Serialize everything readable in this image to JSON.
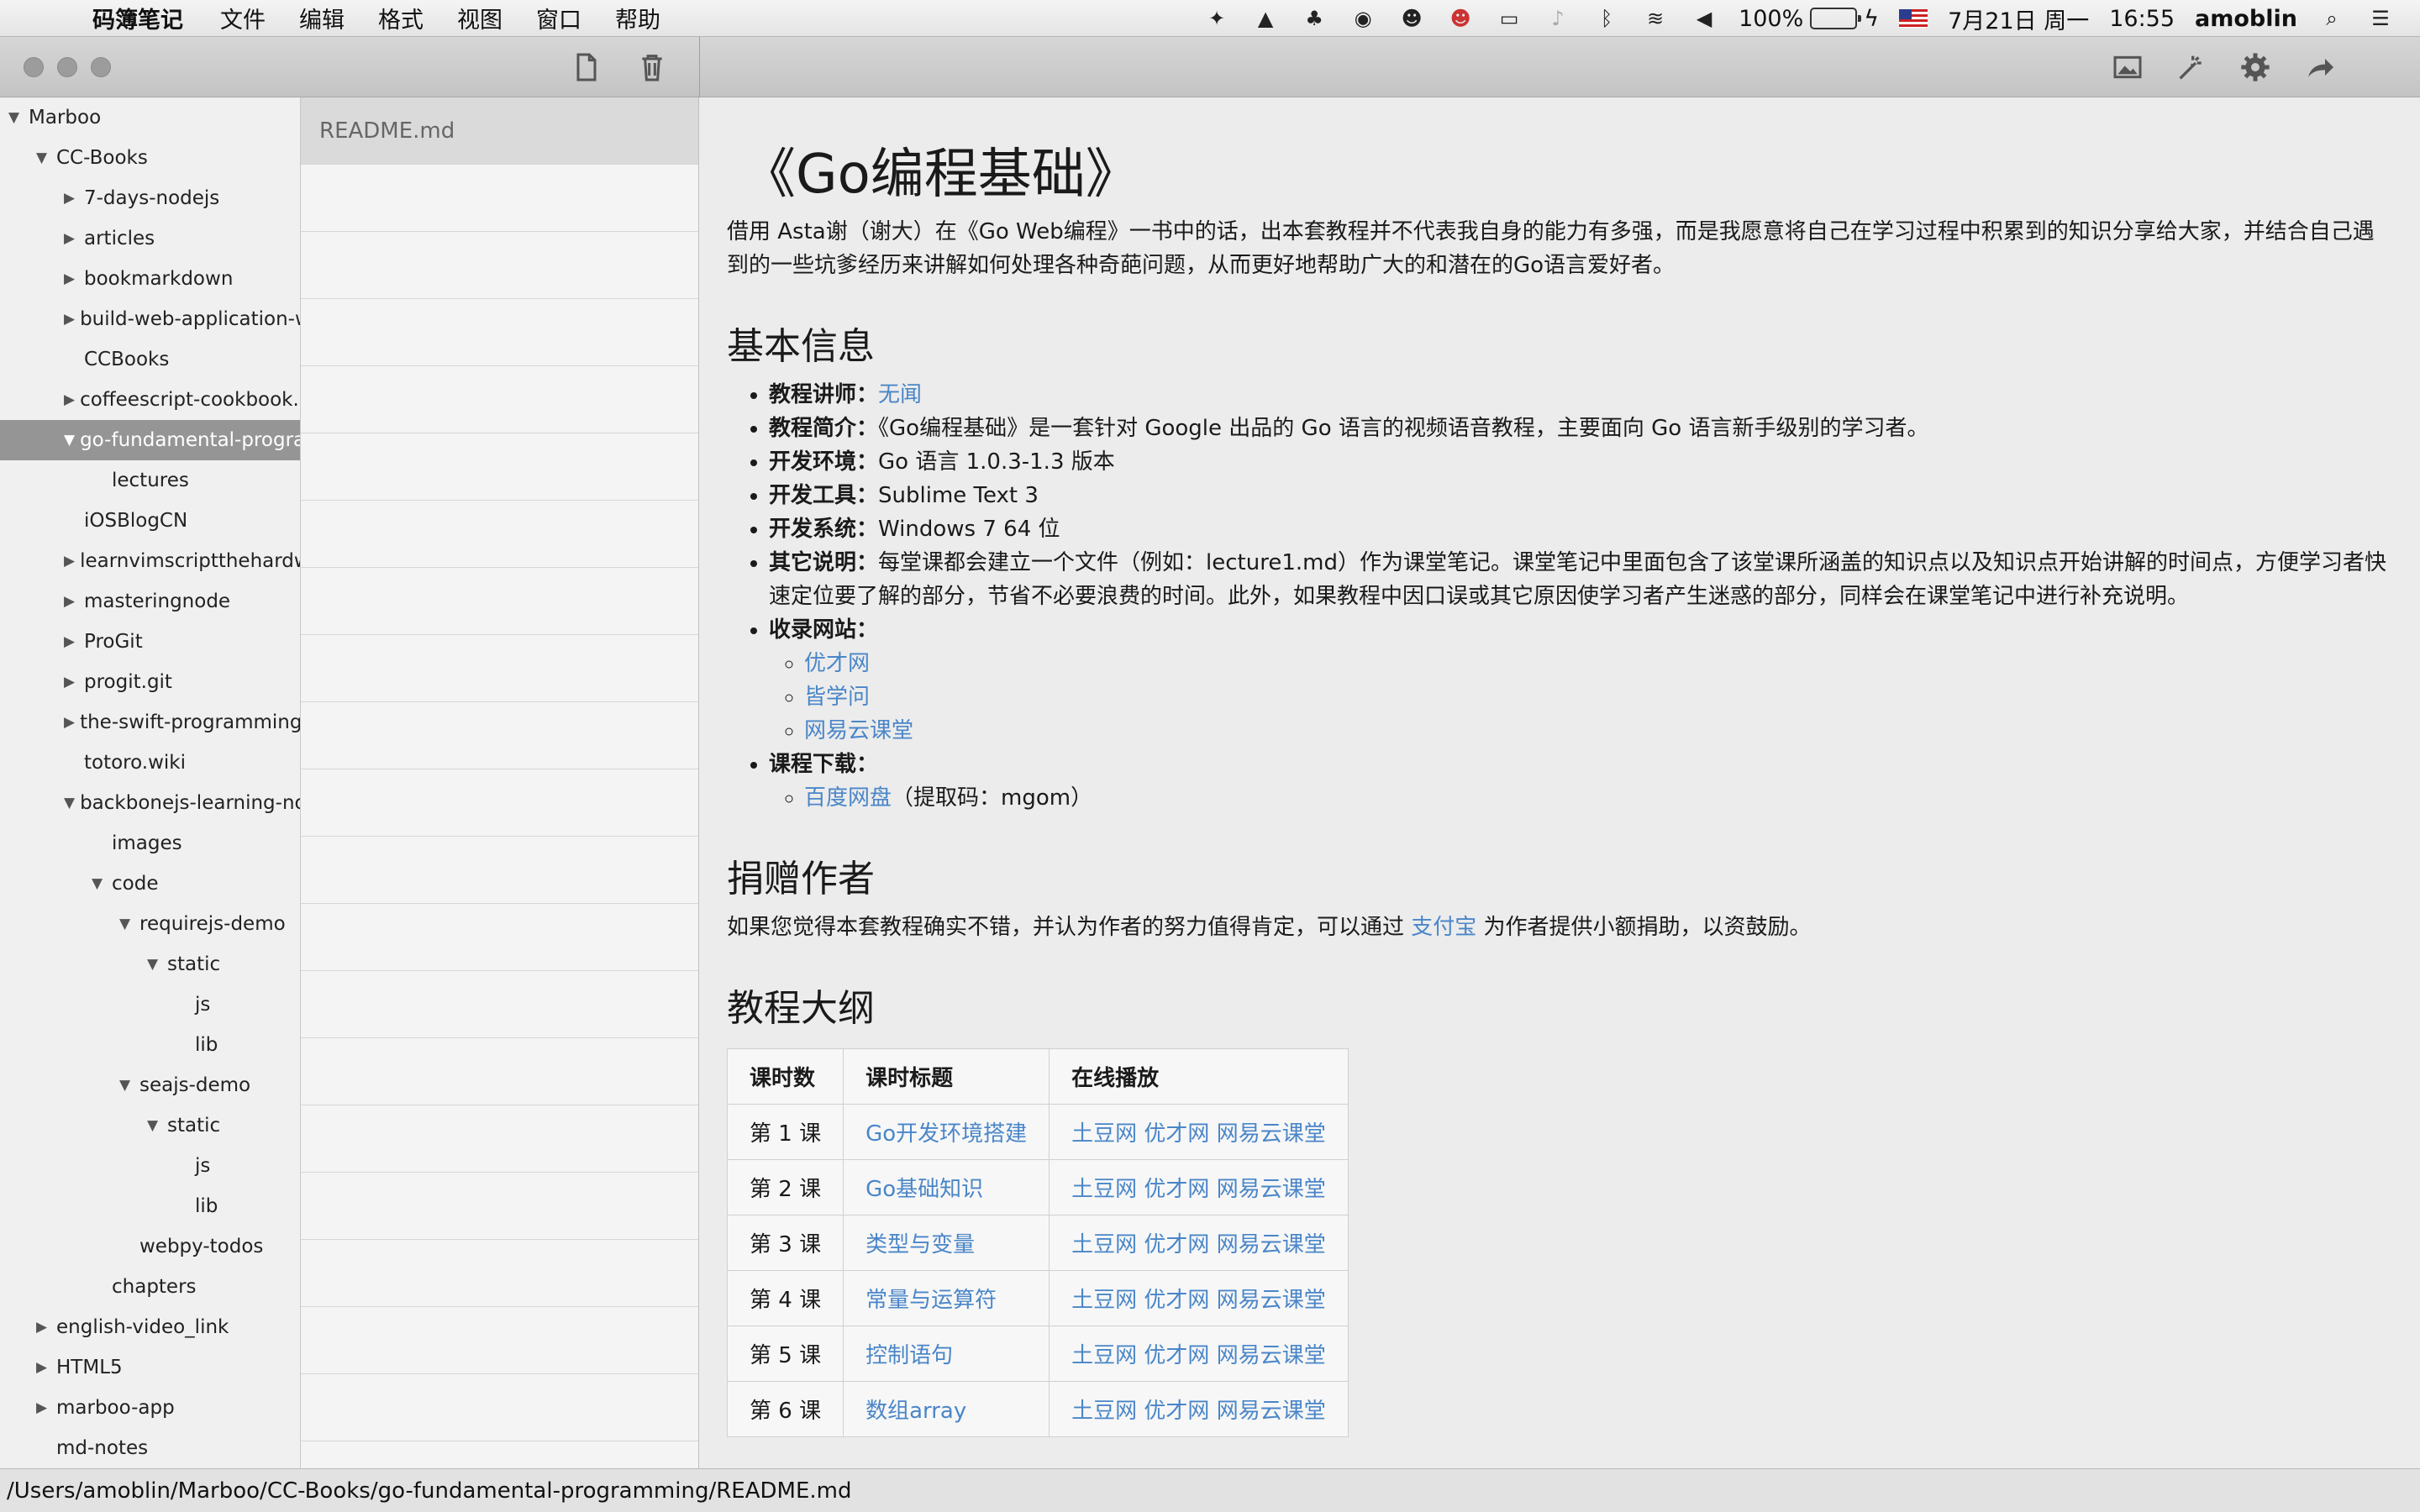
{
  "menubar": {
    "app_name": "码簿笔记",
    "menus": [
      "文件",
      "编辑",
      "格式",
      "视图",
      "窗口",
      "帮助"
    ],
    "battery": "100%",
    "battery_level": 1.0,
    "date": "7月21日 周一",
    "time": "16:55",
    "user": "amoblin"
  },
  "tree": [
    {
      "label": "Marboo",
      "depth": 0,
      "arrow": "down"
    },
    {
      "label": "CC-Books",
      "depth": 1,
      "arrow": "down"
    },
    {
      "label": "7-days-nodejs",
      "depth": 2,
      "arrow": "right"
    },
    {
      "label": "articles",
      "depth": 2,
      "arrow": "right"
    },
    {
      "label": "bookmarkdown",
      "depth": 2,
      "arrow": "right"
    },
    {
      "label": "build-web-application-wi",
      "depth": 2,
      "arrow": "right"
    },
    {
      "label": "CCBooks",
      "depth": 2,
      "arrow": ""
    },
    {
      "label": "coffeescript-cookbook.g",
      "depth": 2,
      "arrow": "right"
    },
    {
      "label": "go-fundamental-program",
      "depth": 2,
      "arrow": "down",
      "selected": true
    },
    {
      "label": "lectures",
      "depth": 3,
      "arrow": ""
    },
    {
      "label": "iOSBlogCN",
      "depth": 2,
      "arrow": ""
    },
    {
      "label": "learnvimscriptthehardwa",
      "depth": 2,
      "arrow": "right"
    },
    {
      "label": "masteringnode",
      "depth": 2,
      "arrow": "right"
    },
    {
      "label": "ProGit",
      "depth": 2,
      "arrow": "right"
    },
    {
      "label": "progit.git",
      "depth": 2,
      "arrow": "right"
    },
    {
      "label": "the-swift-programming-la",
      "depth": 2,
      "arrow": "right"
    },
    {
      "label": "totoro.wiki",
      "depth": 2,
      "arrow": ""
    },
    {
      "label": "backbonejs-learning-not",
      "depth": 2,
      "arrow": "down"
    },
    {
      "label": "images",
      "depth": 3,
      "arrow": ""
    },
    {
      "label": "code",
      "depth": 3,
      "arrow": "down"
    },
    {
      "label": "requirejs-demo",
      "depth": 4,
      "arrow": "down"
    },
    {
      "label": "static",
      "depth": 5,
      "arrow": "down"
    },
    {
      "label": "js",
      "depth": 6,
      "arrow": ""
    },
    {
      "label": "lib",
      "depth": 6,
      "arrow": ""
    },
    {
      "label": "seajs-demo",
      "depth": 4,
      "arrow": "down"
    },
    {
      "label": "static",
      "depth": 5,
      "arrow": "down"
    },
    {
      "label": "js",
      "depth": 6,
      "arrow": ""
    },
    {
      "label": "lib",
      "depth": 6,
      "arrow": ""
    },
    {
      "label": "webpy-todos",
      "depth": 4,
      "arrow": ""
    },
    {
      "label": "chapters",
      "depth": 3,
      "arrow": ""
    },
    {
      "label": "english-video_link",
      "depth": 1,
      "arrow": "right"
    },
    {
      "label": "HTML5",
      "depth": 1,
      "arrow": "right"
    },
    {
      "label": "marboo-app",
      "depth": 1,
      "arrow": "right"
    },
    {
      "label": "md-notes",
      "depth": 1,
      "arrow": ""
    }
  ],
  "filelist": {
    "selected_file": "README.md",
    "empty_rows": 19
  },
  "doc": {
    "title": "《Go编程基础》",
    "intro": "借用 Asta谢（谢大）在《Go Web编程》一书中的话，出本套教程并不代表我自身的能力有多强，而是我愿意将自己在学习过程中积累到的知识分享给大家，并结合自己遇到的一些坑爹经历来讲解如何处理各种奇葩问题，从而更好地帮助广大的和潜在的Go语言爱好者。",
    "section1": "基本信息",
    "info": {
      "teacher_label": "教程讲师：",
      "teacher_link": "无闻",
      "summary_label": "教程简介：",
      "summary": "《Go编程基础》是一套针对 Google 出品的 Go 语言的视频语音教程，主要面向 Go 语言新手级别的学习者。",
      "env_label": "开发环境：",
      "env": "Go 语言 1.0.3-1.3 版本",
      "tool_label": "开发工具：",
      "tool": "Sublime Text 3",
      "os_label": "开发系统：",
      "os": "Windows 7 64 位",
      "other_label": "其它说明：",
      "other": "每堂课都会建立一个文件（例如：lecture1.md）作为课堂笔记。课堂笔记中里面包含了该堂课所涵盖的知识点以及知识点开始讲解的时间点，方便学习者快速定位要了解的部分，节省不必要浪费的时间。此外，如果教程中因口误或其它原因使学习者产生迷惑的部分，同样会在课堂笔记中进行补充说明。",
      "sites_label": "收录网站：",
      "sites": [
        "优才网",
        "皆学问",
        "网易云课堂"
      ],
      "download_label": "课程下载：",
      "download_link": "百度网盘",
      "download_code": "（提取码：mgom）"
    },
    "section2": "捐赠作者",
    "donate_before": "如果您觉得本套教程确实不错，并认为作者的努力值得肯定，可以通过 ",
    "donate_link": "支付宝",
    "donate_after": " 为作者提供小额捐助，以资鼓励。",
    "section3": "教程大纲",
    "table": {
      "headers": [
        "课时数",
        "课时标题",
        "在线播放"
      ],
      "rows": [
        {
          "num": "第 1 课",
          "title": "Go开发环境搭建",
          "links": [
            "土豆网",
            "优才网",
            "网易云课堂"
          ]
        },
        {
          "num": "第 2 课",
          "title": "Go基础知识",
          "links": [
            "土豆网",
            "优才网",
            "网易云课堂"
          ]
        },
        {
          "num": "第 3 课",
          "title": "类型与变量",
          "links": [
            "土豆网",
            "优才网",
            "网易云课堂"
          ]
        },
        {
          "num": "第 4 课",
          "title": "常量与运算符",
          "links": [
            "土豆网",
            "优才网",
            "网易云课堂"
          ]
        },
        {
          "num": "第 5 课",
          "title": "控制语句",
          "links": [
            "土豆网",
            "优才网",
            "网易云课堂"
          ]
        },
        {
          "num": "第 6 课",
          "title": "数组array",
          "links": [
            "土豆网",
            "优才网",
            "网易云课堂"
          ]
        }
      ]
    }
  },
  "statusbar": {
    "path": "/Users/amoblin/Marboo/CC-Books/go-fundamental-programming/README.md"
  },
  "colors": {
    "link": "#4a86c8",
    "selection": "#959595"
  }
}
